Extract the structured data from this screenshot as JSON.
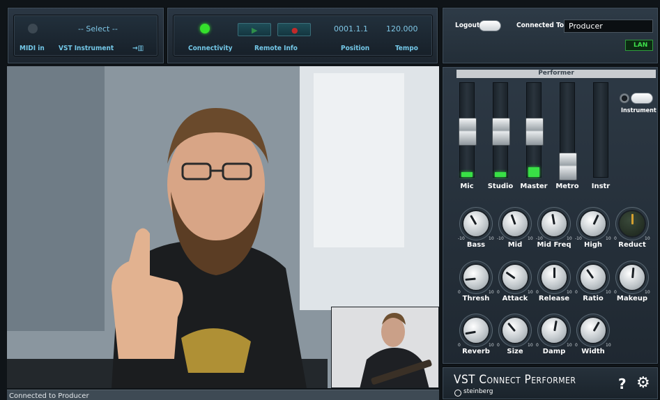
{
  "midi_panel": {
    "select_label": "-- Select --",
    "midi_in_caption": "MIDI in",
    "vst_caption": "VST Instrument",
    "keyboard_caption": "→▥"
  },
  "transport": {
    "connectivity_caption": "Connectivity",
    "remote_info_caption": "Remote Info",
    "position_value": "0001.1.1",
    "position_caption": "Position",
    "tempo_value": "120.000",
    "tempo_caption": "Tempo"
  },
  "connection": {
    "logout_label": "Logout",
    "connected_to_label": "Connected To",
    "connected_to_value": "Producer",
    "lan_label": "LAN"
  },
  "performer": {
    "title": "Performer",
    "instrument_label": "Instrument",
    "faders": [
      {
        "label": "Mic",
        "level": 0.05
      },
      {
        "label": "Studio",
        "level": 0.05
      },
      {
        "label": "Master",
        "level": 0.1
      },
      {
        "label": "Metro",
        "level": 0
      },
      {
        "label": "Instr",
        "level": 0
      }
    ],
    "knobs": [
      {
        "label": "Bass"
      },
      {
        "label": "Mid"
      },
      {
        "label": "Mid Freq"
      },
      {
        "label": "High"
      },
      {
        "label": "Reduct"
      },
      {
        "label": "Thresh"
      },
      {
        "label": "Attack"
      },
      {
        "label": "Release"
      },
      {
        "label": "Ratio"
      },
      {
        "label": "Makeup"
      },
      {
        "label": "Reverb"
      },
      {
        "label": "Size"
      },
      {
        "label": "Damp"
      },
      {
        "label": "Width"
      }
    ],
    "knob_min": "0",
    "knob_max": "10",
    "knob_mid_min": "-10",
    "knob_mid_max": "10"
  },
  "footer": {
    "product": "VST Connect Performer",
    "brand": "steinberg",
    "help_label": "?"
  },
  "status": {
    "text": "Connected to Producer"
  },
  "colors": {
    "accent": "#74c8e8",
    "led_on": "#3ddc3a",
    "record": "#c22a2a",
    "play": "#2f8f4a"
  }
}
